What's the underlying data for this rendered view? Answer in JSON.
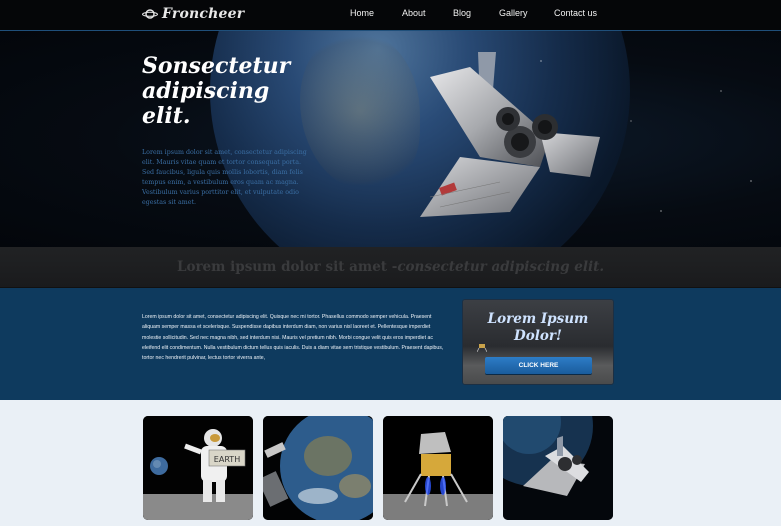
{
  "brand": {
    "name": "Froncheer"
  },
  "nav": {
    "items": [
      "Home",
      "About",
      "Blog",
      "Gallery",
      "Contact us"
    ]
  },
  "hero": {
    "title_lines": [
      "Sonsectetur",
      "adipiscing",
      "elit."
    ],
    "body": "Lorem ipsum dolor sit amet, consectetur adipiscing elit. Mauris vitae quam et tortor consequat porta. Sed faucibus, ligula quis mollis lobortis, diam felis tempus enim, a vestibulum eros quam ac magna. Vestibulum varius porttitor elit, et vulputate odio egestas sit amet."
  },
  "tagline": {
    "plain": "Lorem ipsum dolor sit amet -",
    "italic": "consectetur adipiscing elit."
  },
  "band": {
    "text": "Lorem ipsum dolor sit amet, consectetur adipiscing elit. Quisque nec mi tortor. Phasellus commodo semper vehicula. Praesent aliquam semper massa et scelerisque. Suspendisse dapibus interdum diam, non varius nisl laoreet et. Pellentesque imperdiet molestie sollicitudin. Sed nec magna nibh, sed interdum nisi. Mauris vel pretium nibh. Morbi congue velit quis eros imperdiet ac eleifend elit condimentum. Nulla vestibulum dictum tellus quis iaculis. Duis a diam vitae sem tristique vestibulum. Praesent dapibus, tortor nec hendrerit pulvinar, lectus tortor viverra ante,"
  },
  "promo": {
    "title_lines": [
      "Lorem Ipsum",
      "Dolor!"
    ],
    "button_label": "CLICK HERE"
  },
  "gallery": {
    "items": [
      {
        "icon": "astronaut-photo",
        "sign_text": "EARTH"
      },
      {
        "icon": "earth-photo"
      },
      {
        "icon": "lunar-lander-photo"
      },
      {
        "icon": "space-shuttle-photo"
      }
    ]
  },
  "colors": {
    "accent_blue": "#0e3a5e",
    "button_blue": "#2d7dc7",
    "gallery_bg": "#eaf0f6"
  }
}
